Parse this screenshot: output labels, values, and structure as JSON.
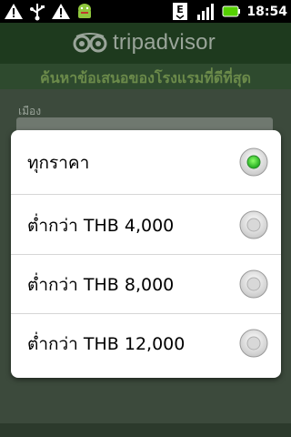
{
  "status_bar": {
    "time": "18:54",
    "icons": [
      "warning-icon",
      "usb-icon",
      "warning-icon",
      "android-icon",
      "edge-signal-icon",
      "signal-bars-icon",
      "battery-icon"
    ]
  },
  "app": {
    "brand": "tripadvisor",
    "subtitle": "ค้นหาข้อเสนอของโรงแรมที่ดีที่สุด",
    "city_label": "เมือง"
  },
  "dialog": {
    "options": [
      {
        "label": "ทุกราคา",
        "selected": true
      },
      {
        "label": "ต่ำกว่า THB 4,000",
        "selected": false
      },
      {
        "label": "ต่ำกว่า THB 8,000",
        "selected": false
      },
      {
        "label": "ต่ำกว่า THB 12,000",
        "selected": false
      }
    ]
  },
  "colors": {
    "accent_green": "#33cc33",
    "header_green": "#1e3a1e"
  }
}
